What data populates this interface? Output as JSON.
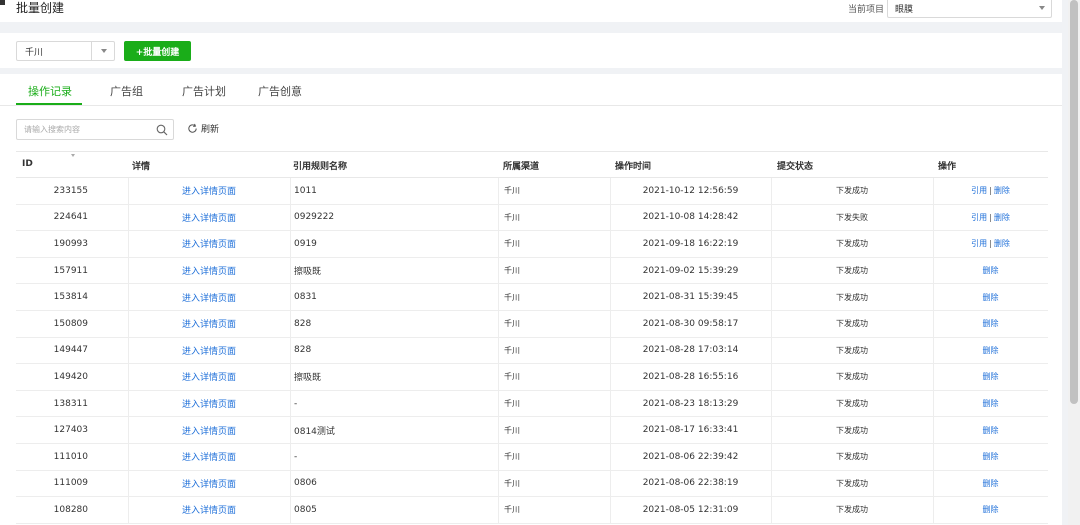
{
  "header": {
    "title": "批量创建",
    "project_label": "当前项目",
    "project_value": "眼膜"
  },
  "filter": {
    "channel_value": "千川",
    "batch_create_label": "+批量创建"
  },
  "tabs": [
    {
      "label": "操作记录",
      "active": true
    },
    {
      "label": "广告组",
      "active": false
    },
    {
      "label": "广告计划",
      "active": false
    },
    {
      "label": "广告创意",
      "active": false
    }
  ],
  "search": {
    "placeholder": "请输入搜索内容",
    "refresh_label": "刷新"
  },
  "table": {
    "columns": [
      "ID",
      "详情",
      "引用规则名称",
      "所属渠道",
      "操作时间",
      "提交状态",
      "操作"
    ],
    "rows": [
      {
        "id": "233155",
        "detail": "进入详情页面",
        "rule": "1011",
        "channel": "千川",
        "time": "2021-10-12 12:56:59",
        "status": "下发成功",
        "ops": [
          "引用",
          "删除"
        ]
      },
      {
        "id": "224641",
        "detail": "进入详情页面",
        "rule": "0929222",
        "channel": "千川",
        "time": "2021-10-08 14:28:42",
        "status": "下发失败",
        "ops": [
          "引用",
          "删除"
        ]
      },
      {
        "id": "190993",
        "detail": "进入详情页面",
        "rule": "0919",
        "channel": "千川",
        "time": "2021-09-18 16:22:19",
        "status": "下发成功",
        "ops": [
          "引用",
          "删除"
        ]
      },
      {
        "id": "157911",
        "detail": "进入详情页面",
        "rule": "擦吸既",
        "channel": "千川",
        "time": "2021-09-02 15:39:29",
        "status": "下发成功",
        "ops": [
          "删除"
        ]
      },
      {
        "id": "153814",
        "detail": "进入详情页面",
        "rule": "0831",
        "channel": "千川",
        "time": "2021-08-31 15:39:45",
        "status": "下发成功",
        "ops": [
          "删除"
        ]
      },
      {
        "id": "150809",
        "detail": "进入详情页面",
        "rule": "828",
        "channel": "千川",
        "time": "2021-08-30 09:58:17",
        "status": "下发成功",
        "ops": [
          "删除"
        ]
      },
      {
        "id": "149447",
        "detail": "进入详情页面",
        "rule": "828",
        "channel": "千川",
        "time": "2021-08-28 17:03:14",
        "status": "下发成功",
        "ops": [
          "删除"
        ]
      },
      {
        "id": "149420",
        "detail": "进入详情页面",
        "rule": "擦吸既",
        "channel": "千川",
        "time": "2021-08-28 16:55:16",
        "status": "下发成功",
        "ops": [
          "删除"
        ]
      },
      {
        "id": "138311",
        "detail": "进入详情页面",
        "rule": "-",
        "channel": "千川",
        "time": "2021-08-23 18:13:29",
        "status": "下发成功",
        "ops": [
          "删除"
        ]
      },
      {
        "id": "127403",
        "detail": "进入详情页面",
        "rule": "0814测试",
        "channel": "千川",
        "time": "2021-08-17 16:33:41",
        "status": "下发成功",
        "ops": [
          "删除"
        ]
      },
      {
        "id": "111010",
        "detail": "进入详情页面",
        "rule": "-",
        "channel": "千川",
        "time": "2021-08-06 22:39:42",
        "status": "下发成功",
        "ops": [
          "删除"
        ]
      },
      {
        "id": "111009",
        "detail": "进入详情页面",
        "rule": "0806",
        "channel": "千川",
        "time": "2021-08-06 22:38:19",
        "status": "下发成功",
        "ops": [
          "删除"
        ]
      },
      {
        "id": "108280",
        "detail": "进入详情页面",
        "rule": "0805",
        "channel": "千川",
        "time": "2021-08-05 12:31:09",
        "status": "下发成功",
        "ops": [
          "删除"
        ]
      }
    ]
  },
  "colors": {
    "accent_green": "#1aad19",
    "link_blue": "#1e6fd9"
  }
}
